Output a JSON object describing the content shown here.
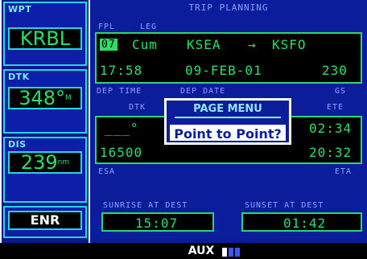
{
  "sidebar": {
    "wpt": {
      "label": "WPT",
      "value": "KRBL"
    },
    "dtk": {
      "label": "DTK",
      "value": "348°",
      "unit": "M"
    },
    "dis": {
      "label": "DIS",
      "value": "239",
      "unit": "nm"
    },
    "mode": {
      "value": "ENR"
    }
  },
  "main": {
    "title": "TRIP PLANNING",
    "fpl_label": "FPL",
    "leg_label": "LEG",
    "fpl_number": "07",
    "leg_mode": "Cum",
    "from": "KSEA",
    "arrow": "→",
    "to": "KSFO",
    "dep_time": "17:58",
    "dep_date": "09-FEB-01",
    "gs": "230",
    "dep_time_label": "DEP TIME",
    "dep_date_label": "DEP DATE",
    "gs_label": "GS",
    "dtk_label": "DTK",
    "ete_label": "ETE",
    "dtk_value": "___°",
    "ete_value": "02:34",
    "esa_value": "16500",
    "eta_value": "20:32",
    "esa_label": "ESA",
    "eta_label": "ETA",
    "sunrise_label": "SUNRISE AT DEST",
    "sunset_label": "SUNSET AT DEST",
    "sunrise_value": "15:07",
    "sunset_value": "01:42"
  },
  "menu": {
    "title": "PAGE MENU",
    "item": "Point to Point?"
  },
  "bottom": {
    "group": "AUX",
    "pages_total": 3,
    "page_active": 1
  },
  "colors": {
    "background": "#0c1d9c",
    "accent_cyan": "#27d7e0",
    "digit_green": "#28e066",
    "label_blue": "#8aa0ff"
  }
}
